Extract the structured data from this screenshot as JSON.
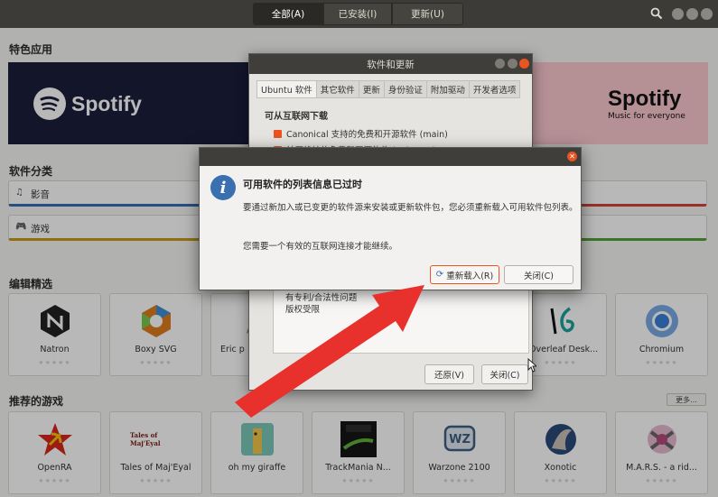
{
  "header": {
    "tabs": [
      {
        "label": "全部(A)",
        "active": true
      },
      {
        "label": "已安装(I)",
        "active": false
      },
      {
        "label": "更新(U)",
        "active": false
      }
    ]
  },
  "featured": {
    "title": "特色应用",
    "banner_left_brand": "Spotify",
    "banner_right_brand": "Spotify",
    "banner_right_tagline": "Music for everyone"
  },
  "categories": {
    "title": "软件分类",
    "items": [
      {
        "label": "影音"
      },
      {
        "label": "游戏"
      }
    ]
  },
  "editors_picks": {
    "title": "编辑精选",
    "tiles": [
      {
        "name": "Natron"
      },
      {
        "name": "Boxy SVG"
      },
      {
        "name": "Eric p"
      },
      {
        "name": ""
      },
      {
        "name": ""
      },
      {
        "name": "Overleaf Desk..."
      },
      {
        "name": "Chromium"
      }
    ]
  },
  "games": {
    "title": "推荐的游戏",
    "more_label": "更多...",
    "tiles": [
      {
        "name": "OpenRA"
      },
      {
        "name": "Tales of Maj'Eyal"
      },
      {
        "name": "oh my giraffe"
      },
      {
        "name": "TrackMania N..."
      },
      {
        "name": "Warzone 2100"
      },
      {
        "name": "Xonotic"
      },
      {
        "name": "M.A.R.S. - a rid..."
      }
    ],
    "tile_texts": {
      "tales_logo": "Tales of Maj'Eyal",
      "wz_logo": "WZ"
    }
  },
  "software_window": {
    "title": "软件和更新",
    "tabs": [
      "Ubuntu 软件",
      "其它软件",
      "更新",
      "身份验证",
      "附加驱动",
      "开发者选项"
    ],
    "heading": "可从互联网下载",
    "checks": [
      "Canonical 支持的免费和开源软件 (main)",
      "社区维护的免费和开源软件 (universe)"
    ],
    "list_items": [
      "有专利/合法性问题",
      "版权受限"
    ],
    "revert_label": "还原(V)",
    "close_label": "关闭(C)"
  },
  "dialog": {
    "title": "可用软件的列表信息已过时",
    "body": "要通过新加入或已变更的软件源来安装或更新软件包，您必须重新载入可用软件包列表。",
    "note": "您需要一个有效的互联网连接才能继续。",
    "reload_label": "重新载入(R)",
    "close_label": "关闭(C)"
  },
  "colors": {
    "accent": "#e95420",
    "headerbar": "#3c3b37",
    "arrow": "#e8312c",
    "info_icon": "#3a6fb0"
  }
}
